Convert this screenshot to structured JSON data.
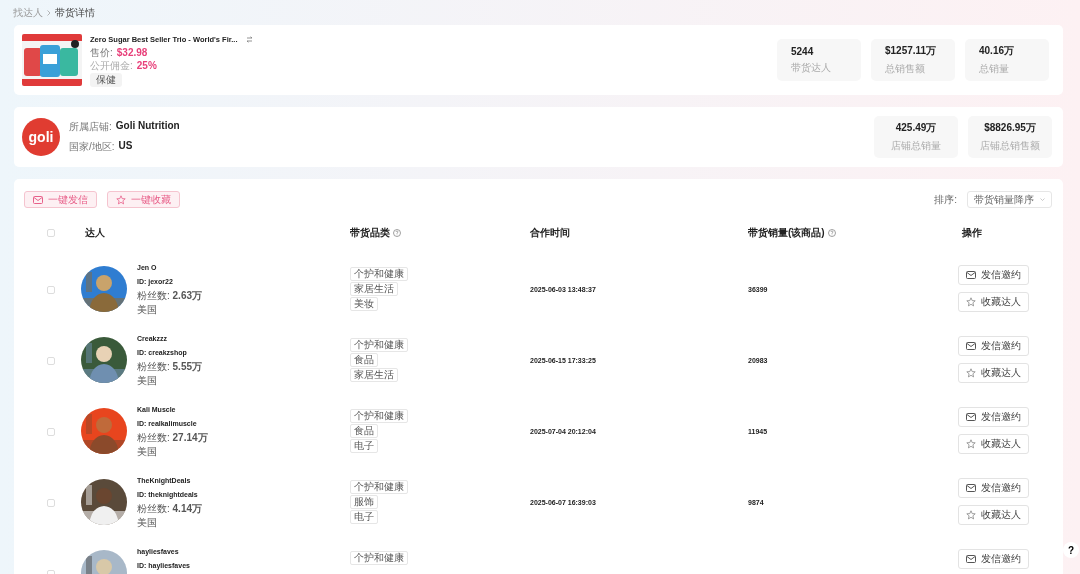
{
  "breadcrumb": [
    {
      "label": "找达人"
    },
    {
      "label": "带货详情"
    }
  ],
  "product": {
    "title": "Zero Sugar Best Seller Trio - World's Fir...",
    "price_label": "售价:",
    "price": "$32.98",
    "commission_label": "公开佣金:",
    "commission": "25%",
    "tag": "保健"
  },
  "product_stats": [
    {
      "value": "5244",
      "label": "带货达人"
    },
    {
      "value": "$1257.11万",
      "label": "总销售额"
    },
    {
      "value": "40.16万",
      "label": "总销量"
    }
  ],
  "store": {
    "logo": "goli",
    "name_label": "所属店铺:",
    "name": "Goli Nutrition",
    "region_label": "国家/地区:",
    "region": "US"
  },
  "store_stats": [
    {
      "value": "425.49万",
      "label": "店铺总销量"
    },
    {
      "value": "$8826.95万",
      "label": "店铺总销售额"
    }
  ],
  "bulk_actions": [
    {
      "label": "一键发信",
      "kind": "mail"
    },
    {
      "label": "一键收藏",
      "kind": "star"
    }
  ],
  "sort": {
    "label": "排序:",
    "value": "带货销量降序"
  },
  "table": {
    "select_all_checked": false,
    "columns": [
      {
        "label": "达人",
        "help": false
      },
      {
        "label": "带货品类",
        "help": true
      },
      {
        "label": "合作时间",
        "help": false
      },
      {
        "label": "带货销量(该商品)",
        "help": true
      },
      {
        "label": "操作",
        "help": false
      }
    ],
    "rows": [
      {
        "checked": false,
        "name": "Jen O",
        "id": "ID: jexor22",
        "fans": "粉丝数: **2.63万**",
        "country": "美国",
        "categories": [
          "个护和健康",
          "家居生活",
          "美妆"
        ],
        "time": "2025-06-03 13:48:37",
        "sales": "36399",
        "actions": [
          "发信邀约",
          "收藏达人"
        ]
      },
      {
        "checked": false,
        "name": "Creakzzz",
        "id": "ID: creakzshop",
        "fans": "粉丝数: **5.55万**",
        "country": "美国",
        "categories": [
          "个护和健康",
          "食品",
          "家居生活"
        ],
        "time": "2025-06-15 17:33:25",
        "sales": "20983",
        "actions": [
          "发信邀约",
          "收藏达人"
        ]
      },
      {
        "checked": false,
        "name": "Kali Muscle",
        "id": "ID: realkalimuscle",
        "fans": "粉丝数: **27.14万**",
        "country": "美国",
        "categories": [
          "个护和健康",
          "食品",
          "电子"
        ],
        "time": "2025-07-04 20:12:04",
        "sales": "11945",
        "actions": [
          "发信邀约",
          "收藏达人"
        ]
      },
      {
        "checked": false,
        "name": "TheKnightDeals",
        "id": "ID: theknightdeals",
        "fans": "粉丝数: **4.14万**",
        "country": "美国",
        "categories": [
          "个护和健康",
          "服饰",
          "电子"
        ],
        "time": "2025-06-07 16:39:03",
        "sales": "9874",
        "actions": [
          "发信邀约",
          "收藏达人"
        ]
      },
      {
        "checked": false,
        "name": "hayliesfaves",
        "id": "ID: hayliesfaves",
        "categories": [
          "个护和健康"
        ],
        "actions": [
          "发信邀约"
        ]
      }
    ]
  },
  "help_button": "?"
}
